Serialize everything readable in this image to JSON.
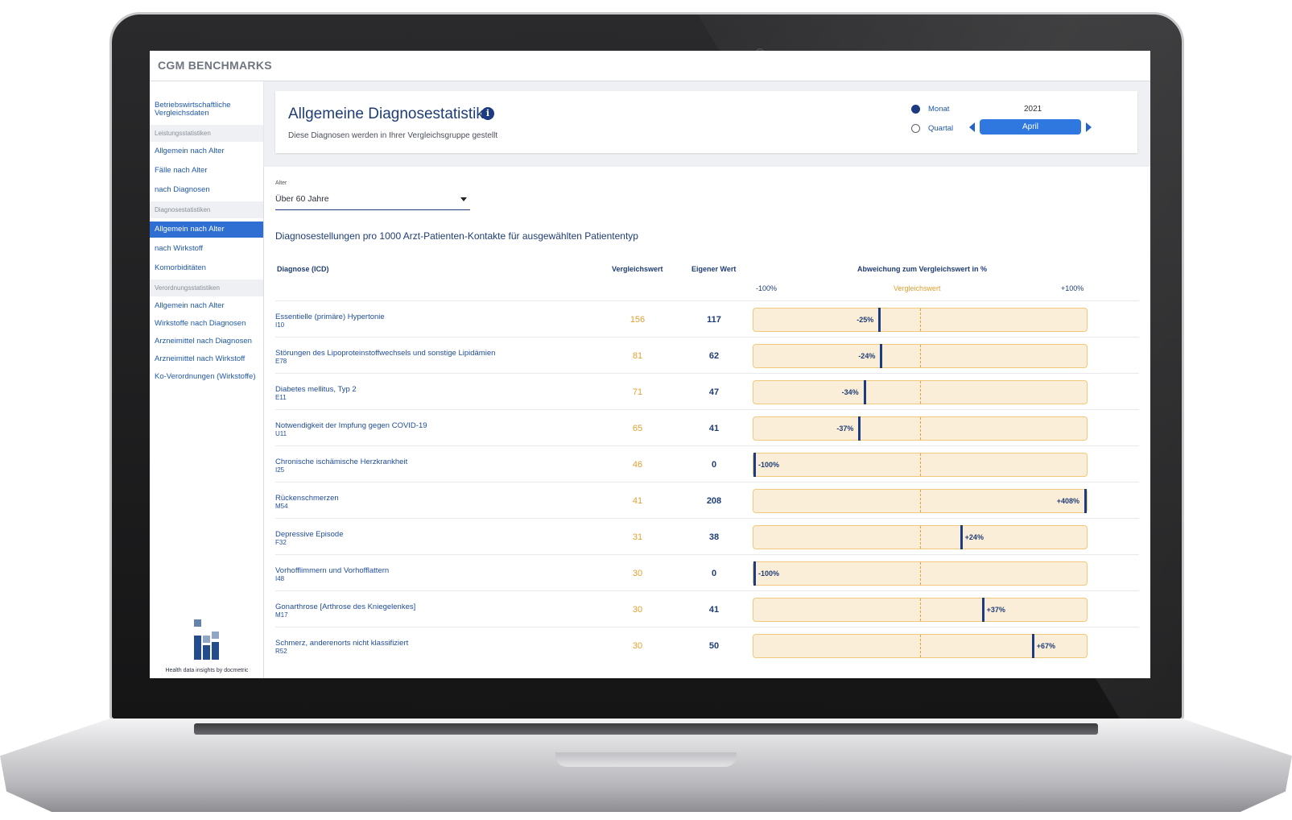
{
  "brand": "CGM BENCHMARKS",
  "sidebar": {
    "top_link": "Betriebswirtschaftliche Vergleichsdaten",
    "sections": [
      {
        "title": "Leistungsstatistiken",
        "items": [
          "Allgemein nach Alter",
          "Fälle nach Alter",
          "nach Diagnosen"
        ]
      },
      {
        "title": "Diagnosestatistiken",
        "items": [
          "Allgemein nach Alter",
          "nach Wirkstoff",
          "Komorbiditäten"
        ]
      },
      {
        "title": "Verordnungsstatistiken",
        "items": [
          "Allgemein nach Alter",
          "Wirkstoffe nach Diagnosen",
          "Arzneimittel nach Diagnosen",
          "Arzneimittel nach Wirkstoff",
          "Ko-Verordnungen (Wirkstoffe)"
        ]
      }
    ],
    "active": "Diagnosestatistiken / Allgemein nach Alter",
    "logo_caption": "Health data insights by docmetric"
  },
  "header": {
    "title": "Allgemeine Diagnosestatistik",
    "subtitle": "Diese Diagnosen werden in Ihrer Vergleichsgruppe gestellt",
    "period_options": [
      "Monat",
      "Quartal"
    ],
    "selected_period": "Monat",
    "year": "2021",
    "month": "April"
  },
  "filter": {
    "label": "Alter",
    "value": "Über 60 Jahre"
  },
  "table": {
    "heading": "Diagnosestellungen pro 1000 Arzt-Patienten-Kontakte für ausgewählten Patiententyp",
    "columns": {
      "diagnosis": "Diagnose (ICD)",
      "reference": "Vergleichswert",
      "own": "Eigener Wert",
      "deviation": "Abweichung zum Vergleichswert in %"
    },
    "scale": {
      "min": "-100%",
      "mid": "Vergleichswert",
      "max": "+100%"
    },
    "rows": [
      {
        "name": "Essentielle (primäre) Hypertonie",
        "code": "I10",
        "reference": "156",
        "own": "117",
        "deviation": "-25%",
        "deviation_pct": -25
      },
      {
        "name": "Störungen des Lipoproteinstoffwechsels und sonstige Lipidämien",
        "code": "E78",
        "reference": "81",
        "own": "62",
        "deviation": "-24%",
        "deviation_pct": -24
      },
      {
        "name": "Diabetes mellitus, Typ 2",
        "code": "E11",
        "reference": "71",
        "own": "47",
        "deviation": "-34%",
        "deviation_pct": -34
      },
      {
        "name": "Notwendigkeit der Impfung gegen COVID-19",
        "code": "U11",
        "reference": "65",
        "own": "41",
        "deviation": "-37%",
        "deviation_pct": -37
      },
      {
        "name": "Chronische ischämische Herzkrankheit",
        "code": "I25",
        "reference": "46",
        "own": "0",
        "deviation": "-100%",
        "deviation_pct": -100
      },
      {
        "name": "Rückenschmerzen",
        "code": "M54",
        "reference": "41",
        "own": "208",
        "deviation": "+408%",
        "deviation_pct": 408
      },
      {
        "name": "Depressive Episode",
        "code": "F32",
        "reference": "31",
        "own": "38",
        "deviation": "+24%",
        "deviation_pct": 24
      },
      {
        "name": "Vorhofflimmern und Vorhofflattern",
        "code": "I48",
        "reference": "30",
        "own": "0",
        "deviation": "-100%",
        "deviation_pct": -100
      },
      {
        "name": "Gonarthrose [Arthrose des Kniegelenkes]",
        "code": "M17",
        "reference": "30",
        "own": "41",
        "deviation": "+37%",
        "deviation_pct": 37
      },
      {
        "name": "Schmerz, anderenorts nicht klassifiziert",
        "code": "R52",
        "reference": "30",
        "own": "50",
        "deviation": "+67%",
        "deviation_pct": 67
      }
    ]
  },
  "colors": {
    "accent": "#2f78e0",
    "navy": "#1d3b80",
    "reference_orange": "#e0a030",
    "bar_fill": "#fbeed8"
  }
}
